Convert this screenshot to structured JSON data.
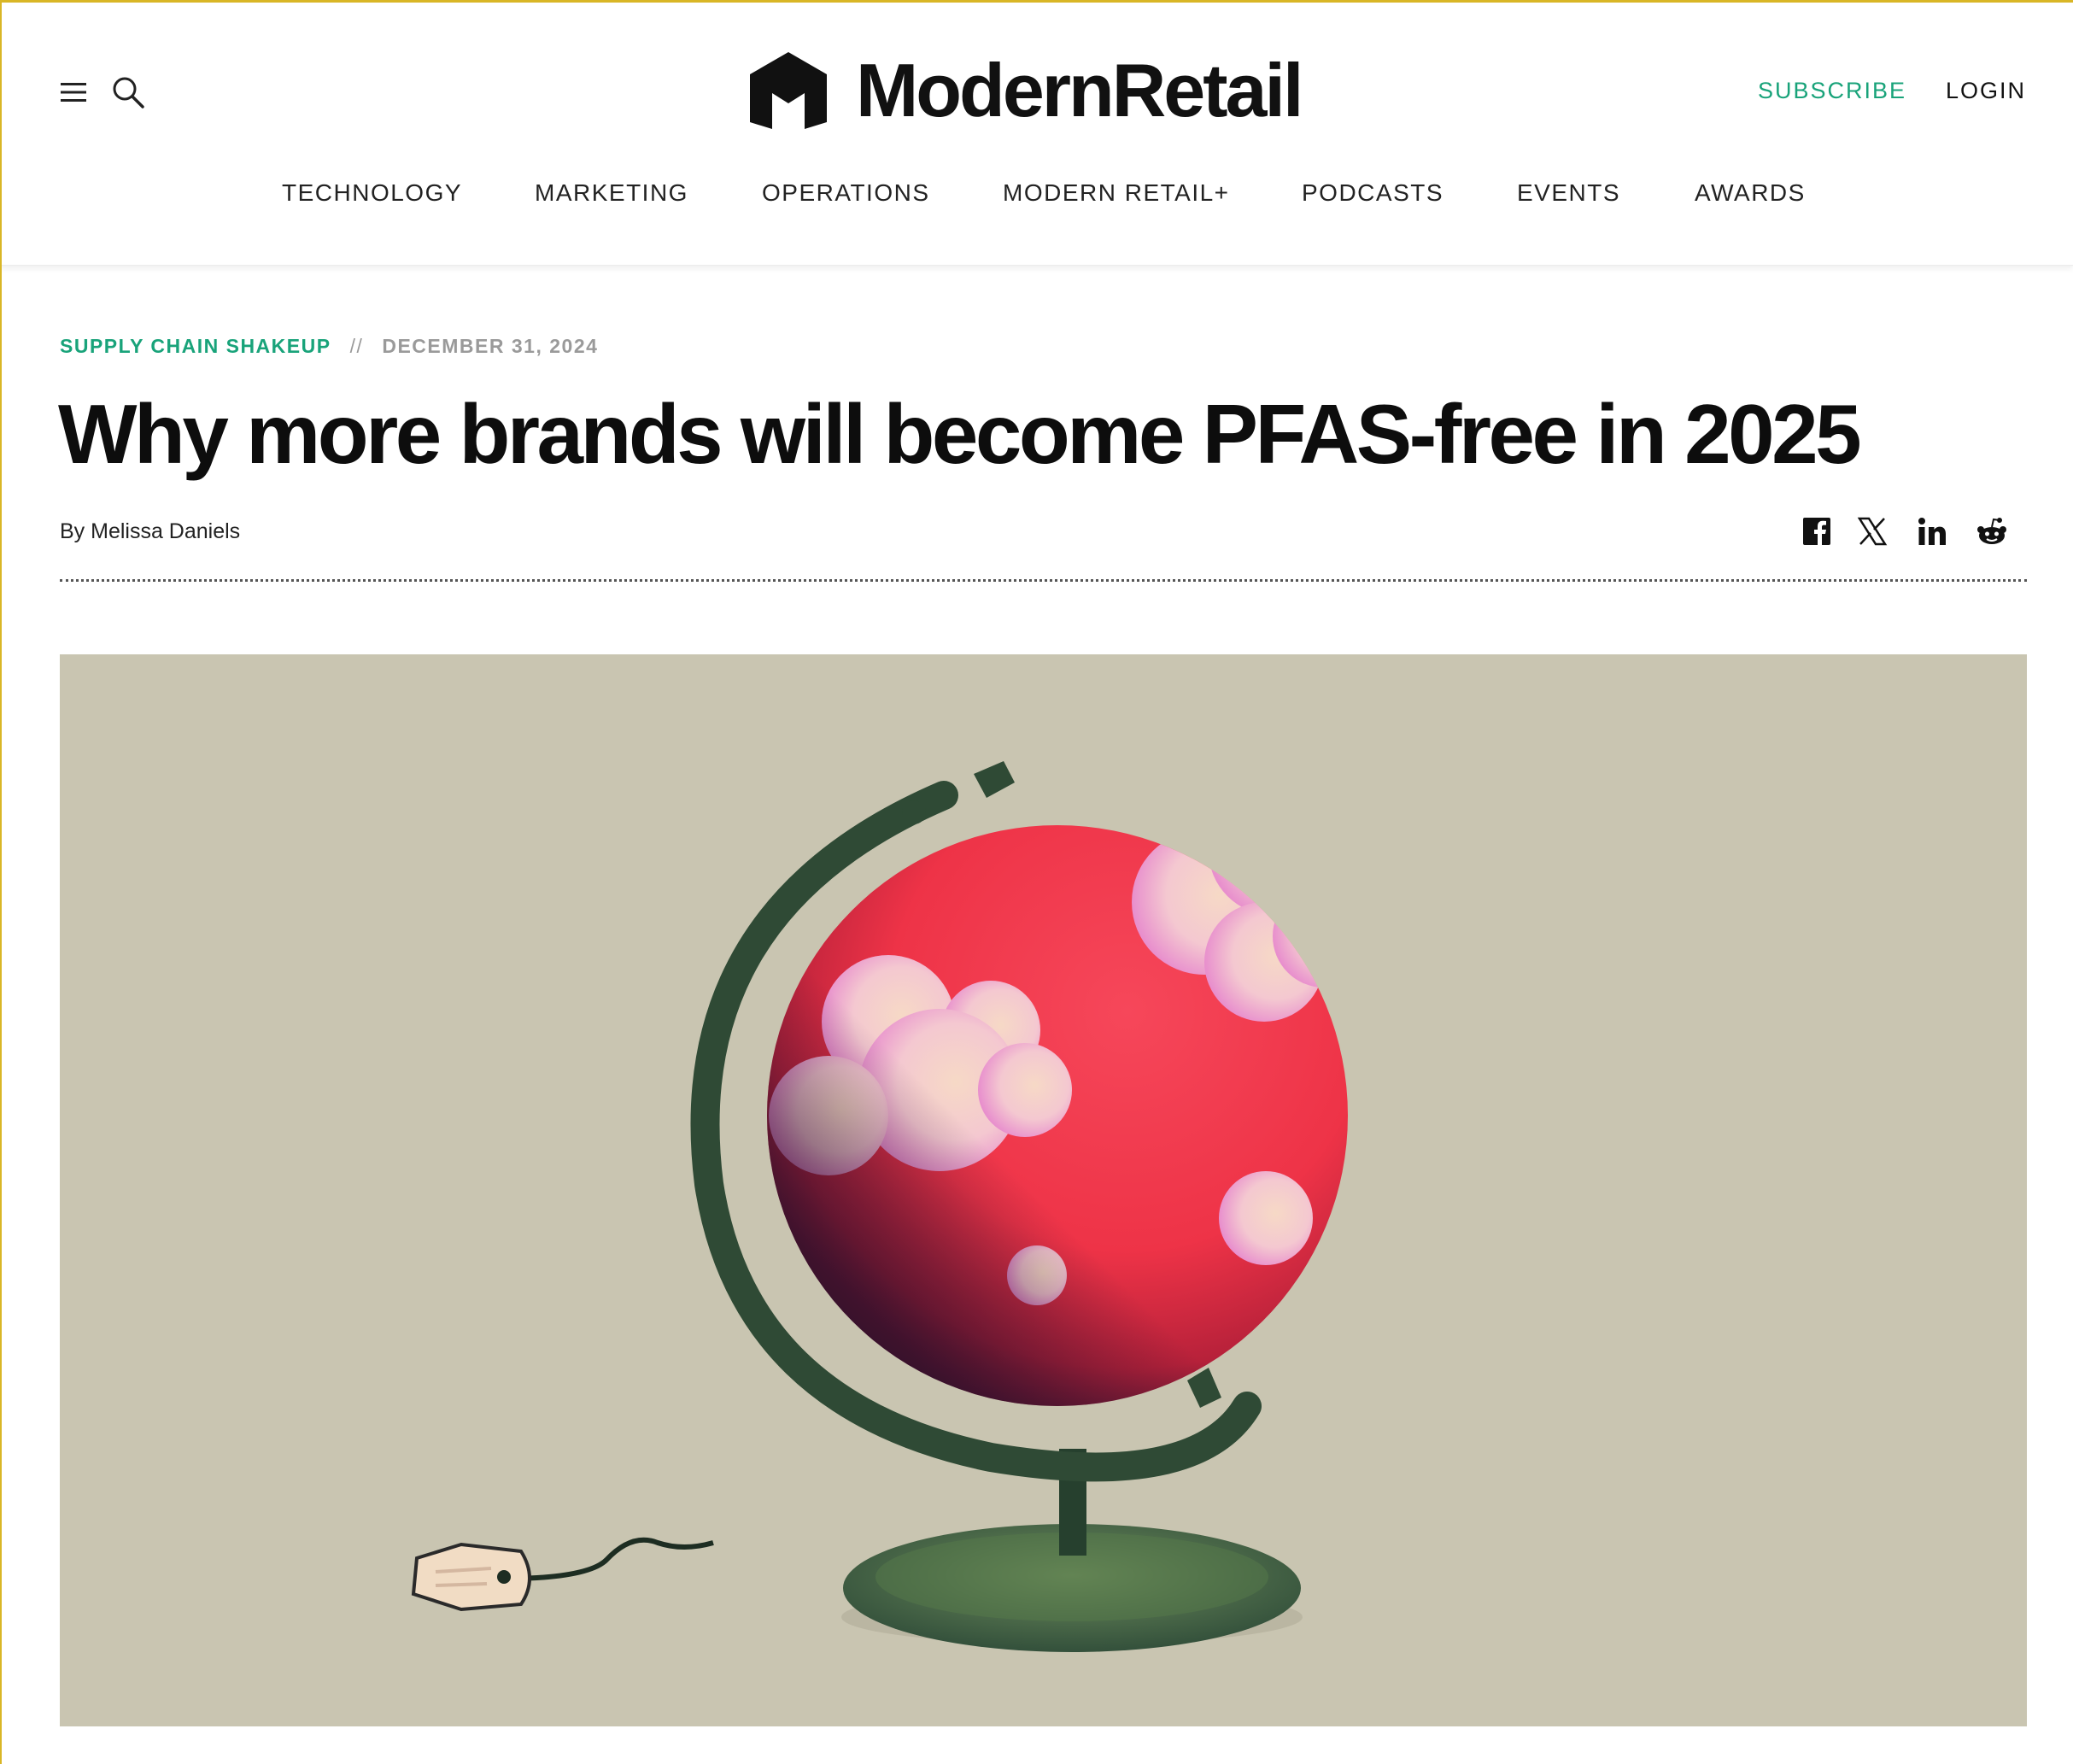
{
  "header": {
    "brand": "ModernRetail",
    "subscribe_label": "SUBSCRIBE",
    "login_label": "LOGIN",
    "icons": [
      "hamburger-menu-icon",
      "search-icon",
      "modern-retail-logo-mark"
    ]
  },
  "nav": {
    "items": [
      {
        "label": "TECHNOLOGY"
      },
      {
        "label": "MARKETING"
      },
      {
        "label": "OPERATIONS"
      },
      {
        "label": "MODERN RETAIL+"
      },
      {
        "label": "PODCASTS"
      },
      {
        "label": "EVENTS"
      },
      {
        "label": "AWARDS"
      }
    ]
  },
  "article": {
    "category": "SUPPLY CHAIN SHAKEUP",
    "separator": "//",
    "date": "DECEMBER 31, 2024",
    "headline": "Why more brands will become PFAS-free in 2025",
    "byline": "By Melissa Daniels",
    "share_icons": [
      "facebook-icon",
      "x-icon",
      "linkedin-icon",
      "reddit-icon"
    ]
  },
  "colors": {
    "accent_green": "#19a37a",
    "frame_gold": "#d9b626",
    "hero_background": "#c9c5b1",
    "globe_red": "#f0354a",
    "stand_green": "#2f4a35"
  }
}
